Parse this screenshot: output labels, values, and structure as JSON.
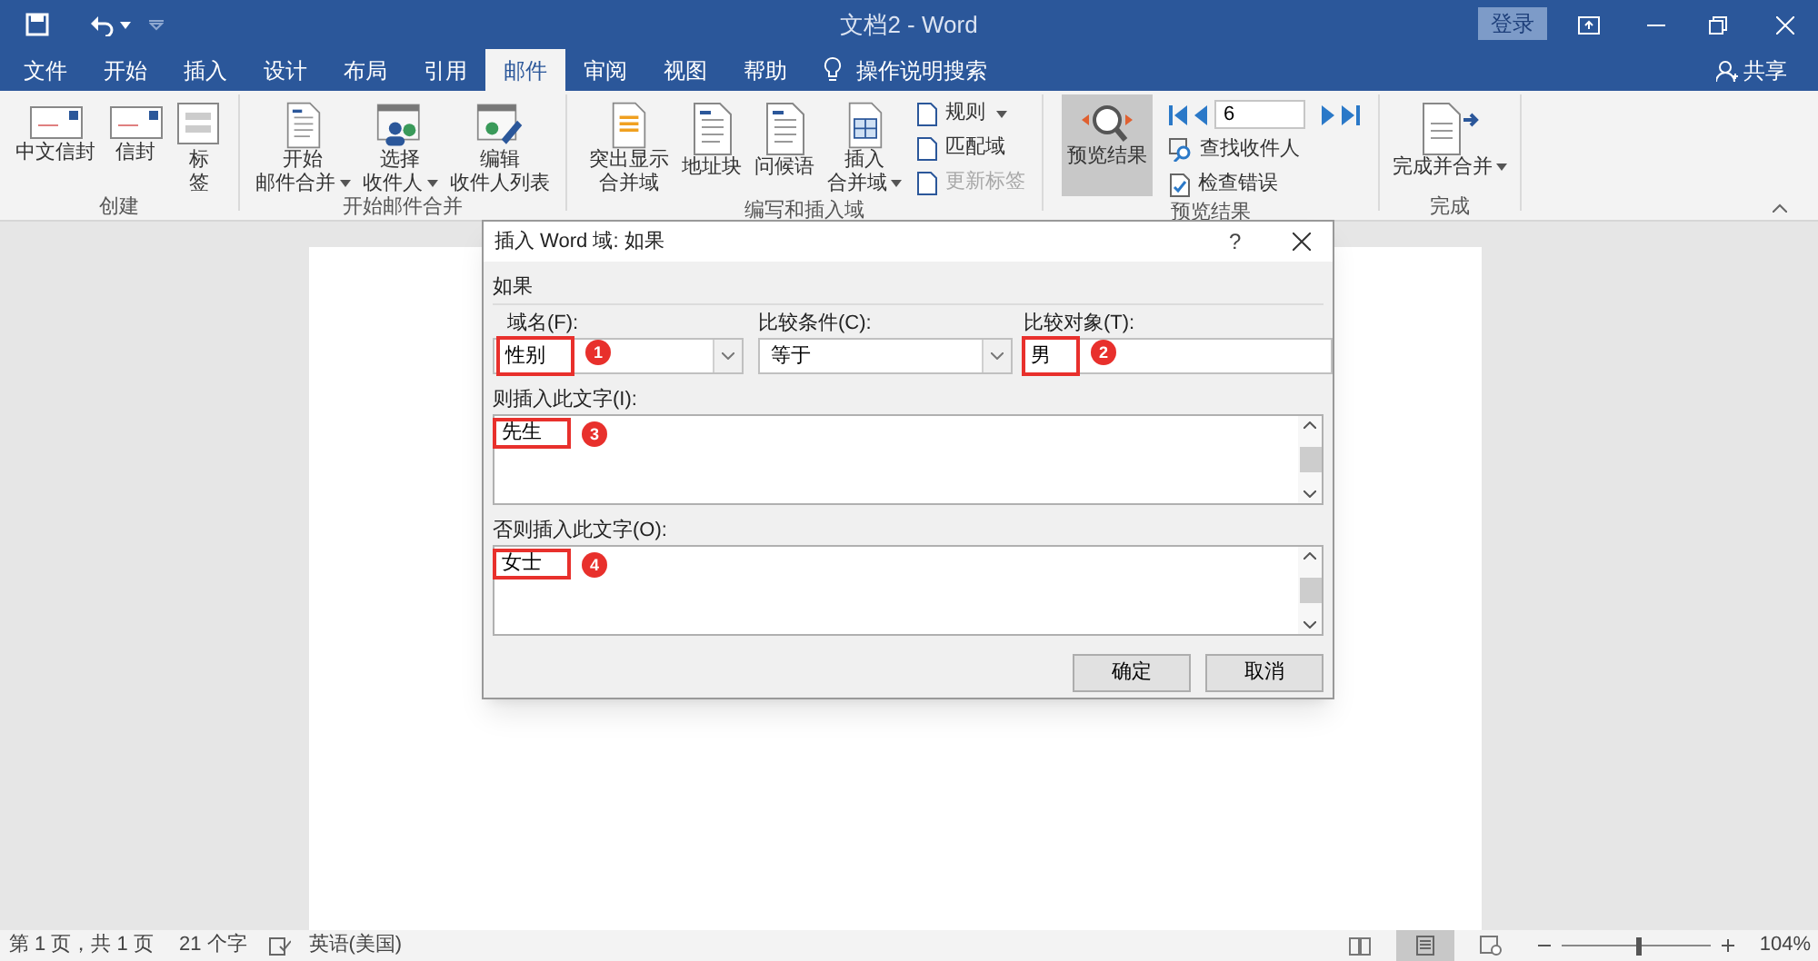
{
  "window": {
    "title": "文档2 - Word",
    "sign_in": "登录"
  },
  "ribbon_tabs": [
    {
      "label": "文件",
      "selected": false
    },
    {
      "label": "开始",
      "selected": false
    },
    {
      "label": "插入",
      "selected": false
    },
    {
      "label": "设计",
      "selected": false
    },
    {
      "label": "布局",
      "selected": false
    },
    {
      "label": "引用",
      "selected": false
    },
    {
      "label": "邮件",
      "selected": true
    },
    {
      "label": "审阅",
      "selected": false
    },
    {
      "label": "视图",
      "selected": false
    },
    {
      "label": "帮助",
      "selected": false
    }
  ],
  "tell_me": "操作说明搜索",
  "share": "共享",
  "ribbon_groups": [
    {
      "label": "创建",
      "items": [
        {
          "kind": "large",
          "lines": [
            "中文信封"
          ],
          "dropdown": false,
          "selected": false
        },
        {
          "kind": "large",
          "lines": [
            "信封"
          ],
          "dropdown": false,
          "selected": false
        },
        {
          "kind": "large",
          "lines": [
            "标",
            "签"
          ],
          "dropdown": false,
          "selected": false
        }
      ]
    },
    {
      "label": "开始邮件合并",
      "items": [
        {
          "kind": "large",
          "lines": [
            "开始",
            "邮件合并"
          ],
          "dropdown": true,
          "selected": false
        },
        {
          "kind": "large",
          "lines": [
            "选择",
            "收件人"
          ],
          "dropdown": true,
          "selected": false
        },
        {
          "kind": "large",
          "lines": [
            "编辑",
            "收件人列表"
          ],
          "dropdown": false,
          "selected": false
        }
      ]
    },
    {
      "label": "编写和插入域",
      "items": [
        {
          "kind": "large",
          "lines": [
            "突出显示",
            "合并域"
          ],
          "dropdown": false,
          "selected": false
        },
        {
          "kind": "large",
          "lines": [
            "地址块"
          ],
          "dropdown": false,
          "selected": false
        },
        {
          "kind": "large",
          "lines": [
            "问候语"
          ],
          "dropdown": false,
          "selected": false
        },
        {
          "kind": "large",
          "lines": [
            "插入",
            "合并域"
          ],
          "dropdown": true,
          "selected": false
        },
        {
          "kind": "stack",
          "buttons": [
            {
              "label": "规则",
              "dropdown": true,
              "disabled": false
            },
            {
              "label": "匹配域",
              "dropdown": false,
              "disabled": false
            },
            {
              "label": "更新标签",
              "dropdown": false,
              "disabled": true
            }
          ]
        }
      ]
    },
    {
      "label": "预览结果",
      "items": [
        {
          "kind": "large",
          "lines": [
            "预览结果"
          ],
          "dropdown": false,
          "selected": true
        },
        {
          "kind": "nav",
          "value": "6",
          "buttons": [
            {
              "label": "查找收件人",
              "dropdown": false,
              "disabled": false
            },
            {
              "label": "检查错误",
              "dropdown": false,
              "disabled": false
            }
          ]
        }
      ]
    },
    {
      "label": "完成",
      "items": [
        {
          "kind": "large",
          "lines": [
            "完成并合并"
          ],
          "dropdown": true,
          "selected": false
        }
      ]
    }
  ],
  "dialog": {
    "title": "插入 Word 域: 如果",
    "help": "?",
    "section": "如果",
    "field_name": {
      "label": "域名(F):",
      "value": "性别"
    },
    "comparison": {
      "label": "比较条件(C):",
      "value": "等于"
    },
    "compare_to": {
      "label": "比较对象(T):",
      "value": "男"
    },
    "then_text": {
      "label": "则插入此文字(I):",
      "value": "先生"
    },
    "else_text": {
      "label": "否则插入此文字(O):",
      "value": "女士"
    },
    "buttons": [
      "确定",
      "取消"
    ]
  },
  "annotations": [
    {
      "label": "1"
    },
    {
      "label": "2"
    },
    {
      "label": "3"
    },
    {
      "label": "4"
    }
  ],
  "status_bar": {
    "items": [
      "第 1 页，共 1 页",
      "21 个字",
      "英语(美国)"
    ],
    "zoom": "104%",
    "zoom_slider": {
      "level": 0.52
    }
  }
}
